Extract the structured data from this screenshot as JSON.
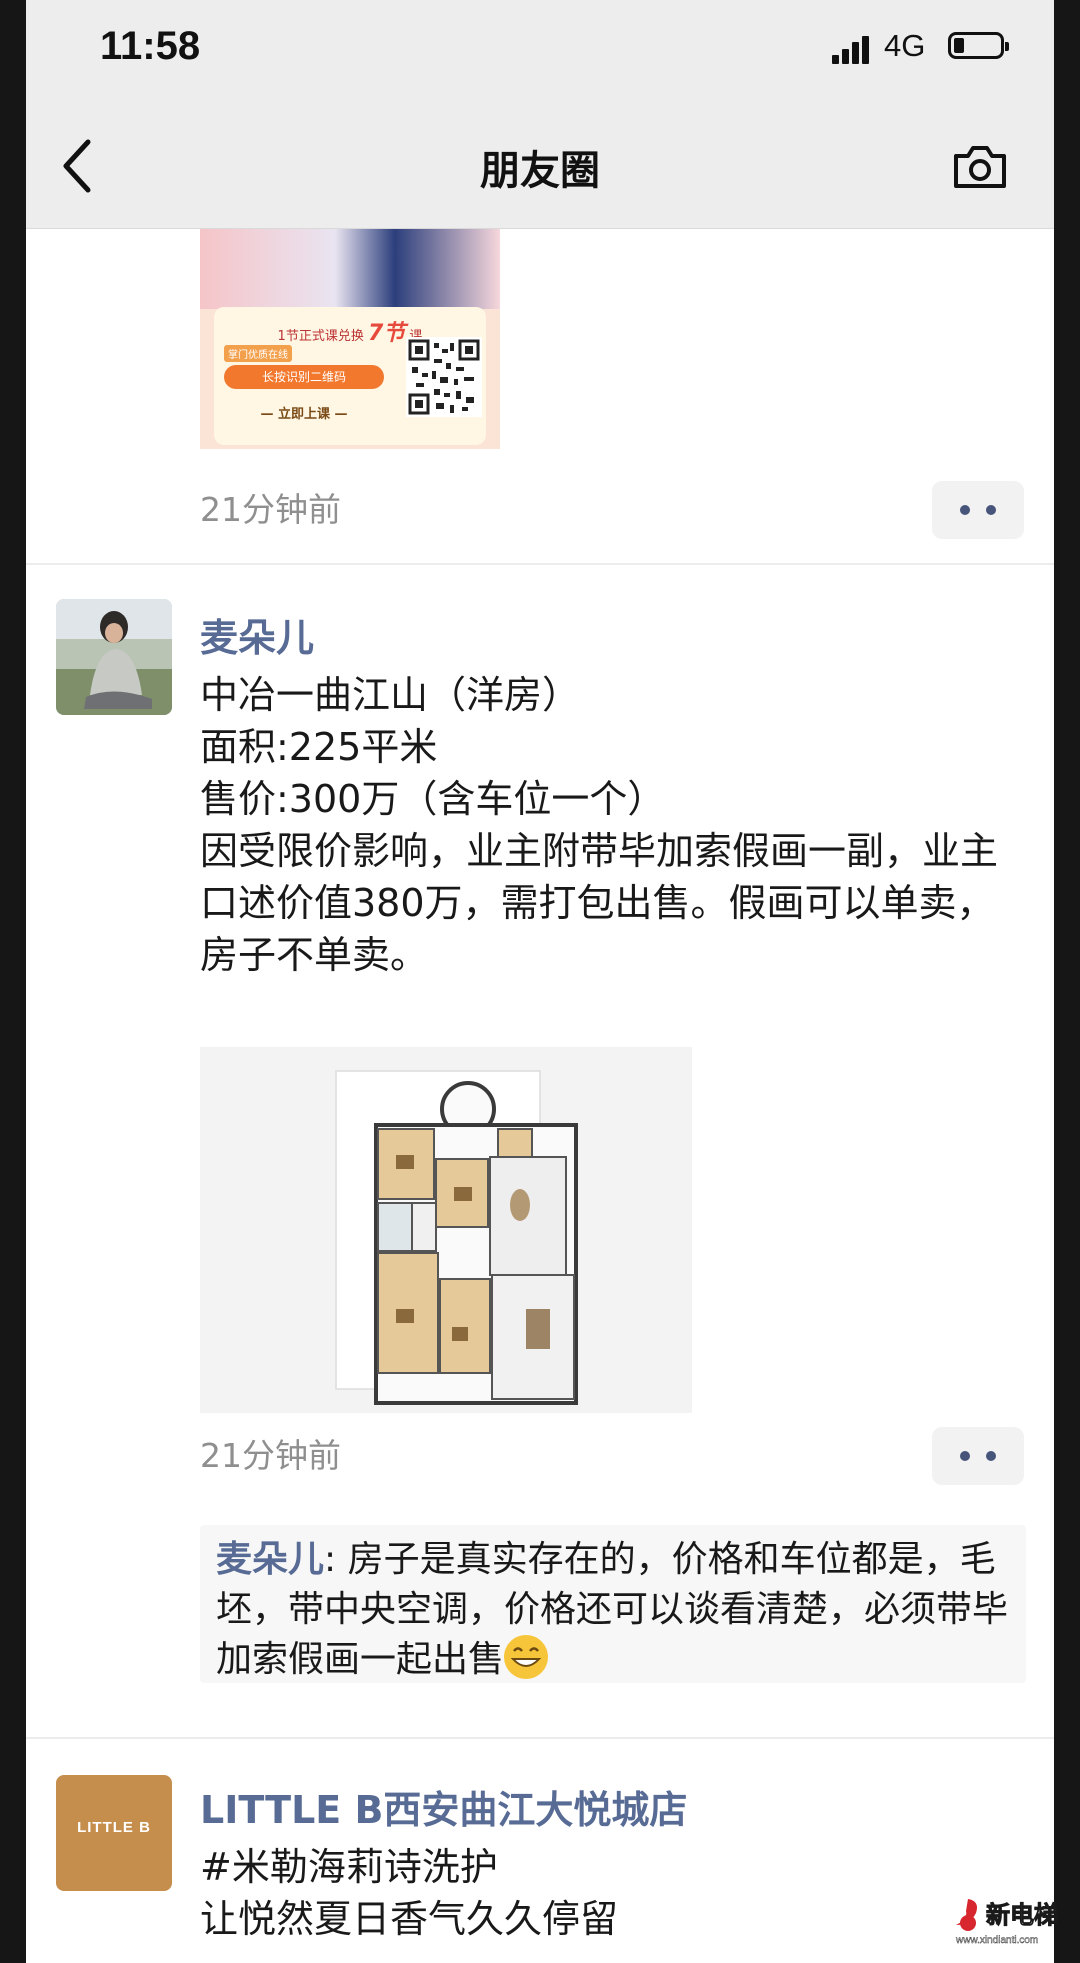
{
  "status_bar": {
    "time": "11:58",
    "network": "4G"
  },
  "nav": {
    "title": "朋友圈"
  },
  "ad_post": {
    "image_text": {
      "exchange": "1节正式课兑换",
      "highlight": "7节",
      "unit": "课",
      "tag": "掌门优质在线",
      "qr_hint": "长按识别二维码",
      "cta": "— 立即上课 —"
    },
    "time": "21分钟前"
  },
  "main_post": {
    "author": "麦朵儿",
    "text": "中冶一曲江山（洋房）\n面积:225平米\n售价:300万（含车位一个）\n因受限价影响，业主附带毕加索假画一副，业主口述价值380万，需打包出售。假画可以单卖，房子不单卖。",
    "time": "21分钟前",
    "comment": {
      "author": "麦朵儿",
      "separator": ": ",
      "text": "房子是真实存在的，价格和车位都是，毛坯，带中央空调，价格还可以谈看清楚，必须带毕加索假画一起出售"
    }
  },
  "next_post": {
    "author": "LITTLE B西安曲江大悦城店",
    "avatar_text": "LITTLE B",
    "text": "#米勒海莉诗洗护\n让悦然夏日香气久久停留"
  },
  "watermark": {
    "text": "新电梯",
    "url": "www.xindianti.com"
  },
  "colors": {
    "link": "#576b95",
    "time": "#8f8f8f",
    "bar": "#ededed"
  }
}
